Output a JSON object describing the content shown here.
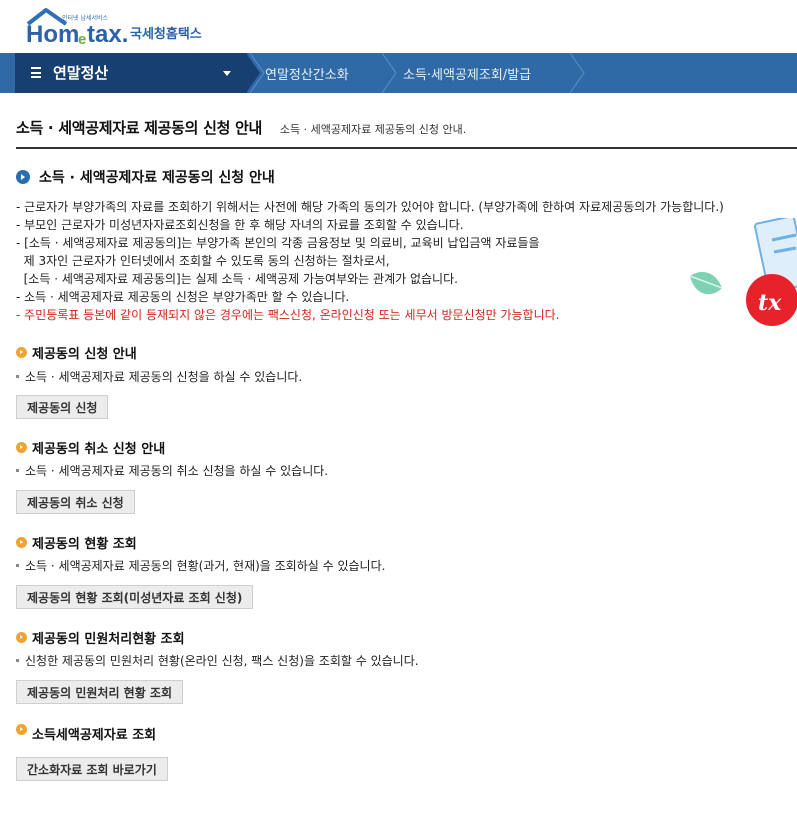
{
  "header": {
    "logo_tagline": "인터넷 납세서비스",
    "logo_main": "Hom",
    "logo_e": "e",
    "logo_tax": "tax.",
    "logo_korean": "국세청홈택스"
  },
  "nav": {
    "menu_title": "연말정산",
    "breadcrumbs": [
      "연말정산간소화",
      "소득·세액공제조회/발급"
    ],
    "colors": {
      "bar": "#2f6aa7",
      "menu": "#173f70"
    }
  },
  "page": {
    "title": "소득 · 세액공제자료 제공동의 신청 안내",
    "subtitle": "소득 · 세액공제자료 제공동의 신청 안내."
  },
  "guide": {
    "title": "소득 · 세액공제자료 제공동의 신청 안내",
    "notes": [
      "- 근로자가 부양가족의 자료를 조회하기 위해서는 사전에 해당 가족의 동의가 있어야 합니다. (부양가족에 한하여 자료제공동의가 가능합니다.)",
      "- 부모인 근로자가 미성년자자료조회신청을 한 후 해당 자녀의 자료를 조회할 수 있습니다.",
      "- [소득 · 세액공제자료 제공동의]는 부양가족 본인의 각종 금융정보 및 의료비, 교육비 납입금액 자료들을",
      "  제 3자인 근로자가 인터넷에서 조회할 수 있도록 동의 신청하는 절차로서,",
      "  [소득 · 세액공제자료 제공동의]는 실제 소득 · 세액공제 가능여부와는 관계가 없습니다.",
      "- 소득 · 세액공제자료 제공동의 신청은 부양가족만 할 수 있습니다."
    ],
    "warning": "- 주민등록표 등본에 같이 등재되지 않은 경우에는 팩스신청, 온라인신청 또는 세무서 방문신청만 가능합니다.",
    "warning_color": "#d0261a"
  },
  "sections": [
    {
      "title": "제공동의 신청 안내",
      "desc": "소득 · 세액공제자료 제공동의 신청을 하실 수 있습니다.",
      "button": "제공동의 신청"
    },
    {
      "title": "제공동의 취소 신청 안내",
      "desc": "소득 · 세액공제자료 제공동의 취소 신청을 하실 수 있습니다.",
      "button": "제공동의 취소 신청"
    },
    {
      "title": "제공동의 현황 조회",
      "desc": "소득 · 세액공제자료 제공동의 현황(과거, 현재)을 조회하실 수 있습니다.",
      "button": "제공동의 현황 조회(미성년자료 조회 신청)"
    },
    {
      "title": "제공동의 민원처리현황 조회",
      "desc": "신청한 제공동의 민원처리 현황(온라인 신청, 팩스 신청)을 조회할 수 있습니다.",
      "button": "제공동의 민원처리 현황 조회"
    },
    {
      "title": "소득세액공제자료 조회",
      "button": "간소화자료 조회 바로가기"
    }
  ]
}
